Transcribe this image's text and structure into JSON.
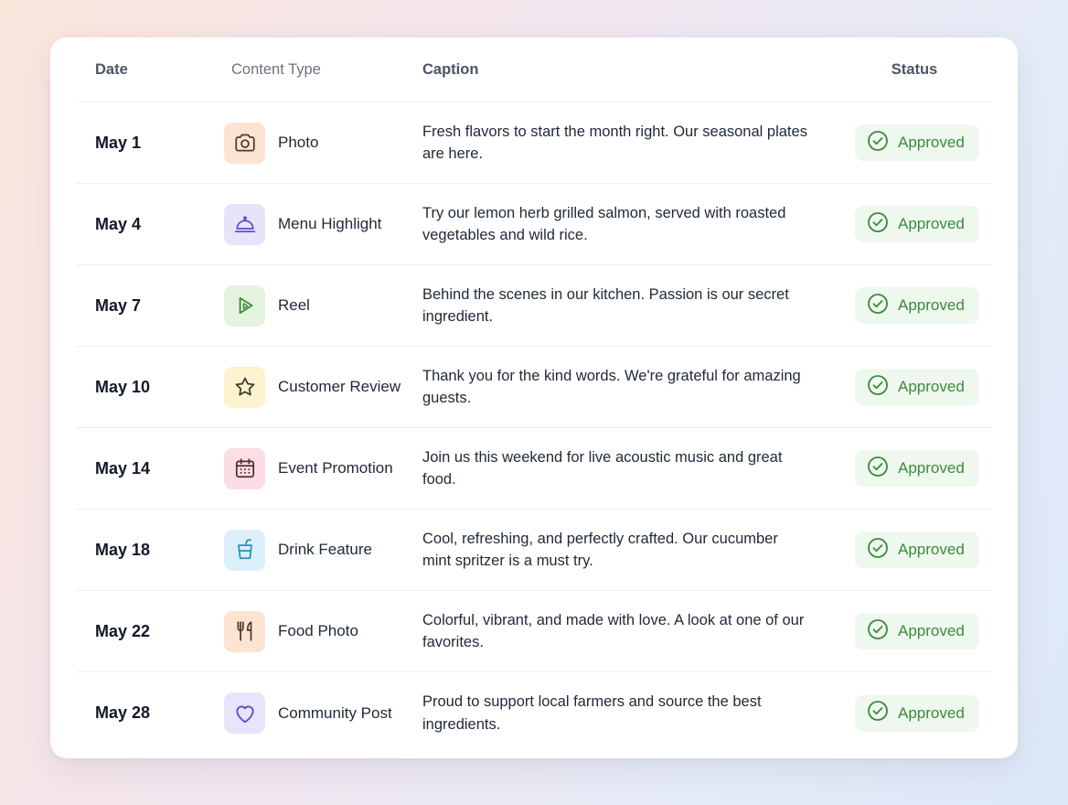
{
  "header": {
    "date": "Date",
    "content_type": "Content Type",
    "caption": "Caption",
    "status": "Status"
  },
  "colors": {
    "approved_text": "#3a8a3c",
    "approved_bg": "#eff8ee"
  },
  "rows": [
    {
      "date": "May 1",
      "type": "Photo",
      "icon": "camera-icon",
      "icon_bg": "#fde3d2",
      "icon_color": "#4b3b33",
      "caption": "Fresh flavors to start the month right. Our seasonal plates are here.",
      "status": "Approved"
    },
    {
      "date": "May 4",
      "type": "Menu Highlight",
      "icon": "cloche-icon",
      "icon_bg": "#e6e3fb",
      "icon_color": "#5b4fc4",
      "caption": "Try our lemon herb grilled salmon, served with roasted vegetables and wild rice.",
      "status": "Approved"
    },
    {
      "date": "May 7",
      "type": "Reel",
      "icon": "play-icon",
      "icon_bg": "#e3f3df",
      "icon_color": "#3f8a3b",
      "caption": "Behind the scenes in our kitchen. Passion is our secret ingredient.",
      "status": "Approved"
    },
    {
      "date": "May 10",
      "type": "Customer Review",
      "icon": "star-icon",
      "icon_bg": "#fdf3cf",
      "icon_color": "#3b3a2c",
      "caption": "Thank you for the kind words. We're grateful for amazing guests.",
      "status": "Approved"
    },
    {
      "date": "May 14",
      "type": "Event Promotion",
      "icon": "calendar-icon",
      "icon_bg": "#fbdde3",
      "icon_color": "#4a2f35",
      "caption": "Join us this weekend for live acoustic music and great food.",
      "status": "Approved"
    },
    {
      "date": "May 18",
      "type": "Drink Feature",
      "icon": "cup-icon",
      "icon_bg": "#dcf0fb",
      "icon_color": "#2a8ec4",
      "caption": "Cool, refreshing, and perfectly crafted. Our cucumber mint spritzer is a must try.",
      "status": "Approved"
    },
    {
      "date": "May 22",
      "type": "Food Photo",
      "icon": "utensils-icon",
      "icon_bg": "#fde3d2",
      "icon_color": "#4b3b33",
      "caption": "Colorful, vibrant, and made with love. A look at one of our favorites.",
      "status": "Approved"
    },
    {
      "date": "May 28",
      "type": "Community Post",
      "icon": "heart-icon",
      "icon_bg": "#e9e4fb",
      "icon_color": "#5b4fc4",
      "caption": "Proud to support local farmers and source the best ingredients.",
      "status": "Approved"
    }
  ]
}
